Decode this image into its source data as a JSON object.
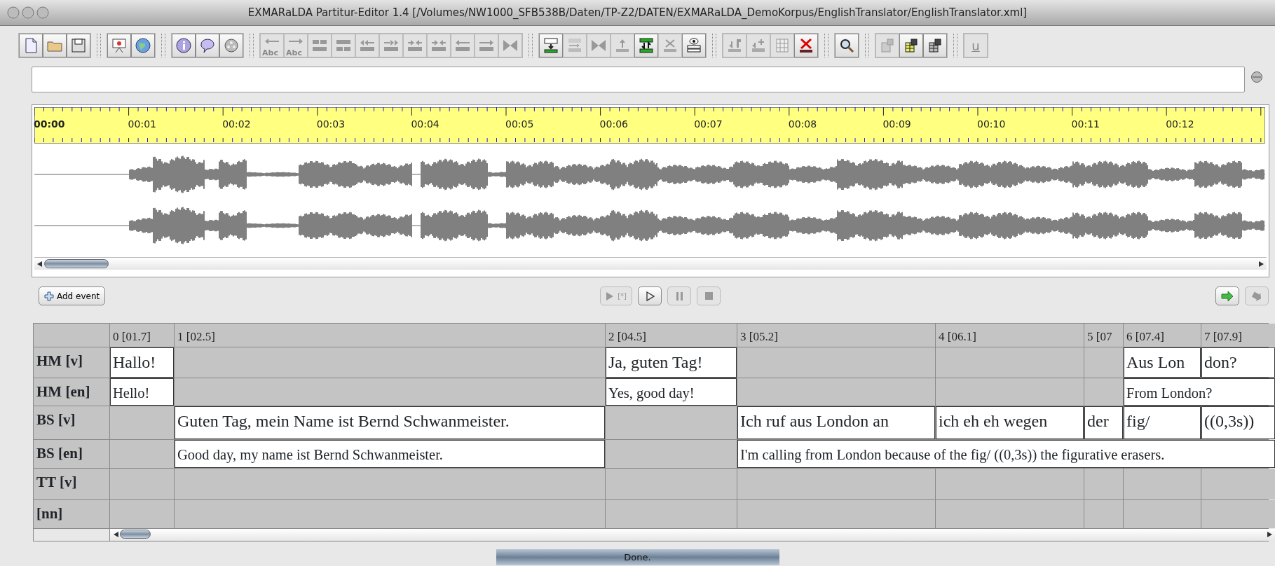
{
  "window": {
    "title": "EXMARaLDA Partitur-Editor 1.4 [/Volumes/NW1000_SFB538B/Daten/TP-Z2/DATEN/EXMARaLDA_DemoKorpus/EnglishTranslator/EnglishTranslator.xml]"
  },
  "toolbar": {
    "groups": [
      {
        "buttons": [
          {
            "disabled": false
          },
          {
            "disabled": false
          },
          {
            "disabled": false
          }
        ]
      },
      {
        "buttons": [
          {
            "disabled": false
          },
          {
            "disabled": false
          }
        ]
      },
      {
        "buttons": [
          {
            "disabled": false
          },
          {
            "disabled": false
          },
          {
            "disabled": false
          }
        ]
      },
      {
        "buttons": [
          {
            "label": "Abc",
            "disabled": true
          },
          {
            "label": "Abc",
            "disabled": true
          },
          {
            "disabled": true
          },
          {
            "disabled": true
          },
          {
            "disabled": true
          },
          {
            "disabled": true
          },
          {
            "disabled": true
          },
          {
            "disabled": true
          },
          {
            "disabled": true
          },
          {
            "disabled": true
          },
          {
            "disabled": true
          }
        ]
      },
      {
        "buttons": [
          {
            "disabled": false
          },
          {
            "disabled": true
          },
          {
            "disabled": true
          },
          {
            "disabled": true
          },
          {
            "disabled": false
          },
          {
            "disabled": true
          },
          {
            "disabled": false
          }
        ]
      },
      {
        "buttons": [
          {
            "disabled": true
          },
          {
            "disabled": true
          },
          {
            "disabled": true
          },
          {
            "disabled": false
          }
        ]
      },
      {
        "buttons": [
          {
            "disabled": false
          }
        ]
      },
      {
        "buttons": [
          {
            "disabled": true
          },
          {
            "disabled": false
          },
          {
            "disabled": false
          }
        ]
      },
      {
        "buttons": [
          {
            "label": "u",
            "disabled": true
          }
        ]
      }
    ]
  },
  "timeline": {
    "ruler": [
      {
        "text": "00:00",
        "current": true
      },
      {
        "text": "00:01",
        "current": false
      },
      {
        "text": "00:02",
        "current": false
      },
      {
        "text": "00:03",
        "current": false
      },
      {
        "text": "00:04",
        "current": false
      },
      {
        "text": "00:05",
        "current": false
      },
      {
        "text": "00:06",
        "current": false
      },
      {
        "text": "00:07",
        "current": false
      },
      {
        "text": "00:08",
        "current": false
      },
      {
        "text": "00:09",
        "current": false
      },
      {
        "text": "00:10",
        "current": false
      },
      {
        "text": "00:11",
        "current": false
      },
      {
        "text": "00:12",
        "current": false
      }
    ]
  },
  "add_event": {
    "label": "Add event"
  },
  "player": {
    "buttons": [
      {
        "kind": "play-selection",
        "label": "[*]",
        "disabled": true
      },
      {
        "kind": "play",
        "disabled": false
      },
      {
        "kind": "pause",
        "disabled": true
      },
      {
        "kind": "stop",
        "disabled": true
      }
    ]
  },
  "nav_buttons": [
    {
      "disabled": false
    },
    {
      "disabled": true
    }
  ],
  "partitur": {
    "columns": [
      "0 [01.7]",
      "1 [02.5]",
      "2 [04.5]",
      "3 [05.2]",
      "4 [06.1]",
      "5 [07",
      "6 [07.4]",
      "7 [07.9]"
    ],
    "rows": [
      {
        "label": "HM [v]",
        "kind": "verbal",
        "cells": [
          {
            "kind": "event",
            "text": "Hallo!"
          },
          {
            "kind": "empty"
          },
          {
            "kind": "event",
            "text": "Ja, guten Tag!"
          },
          {
            "kind": "empty"
          },
          {
            "kind": "empty"
          },
          {
            "kind": "empty"
          },
          {
            "kind": "event",
            "text": "Aus Lon"
          },
          {
            "kind": "event",
            "text": "don?"
          }
        ]
      },
      {
        "label": "HM [en]",
        "kind": "translation",
        "cells": [
          {
            "kind": "event",
            "text": "Hello!"
          },
          {
            "kind": "empty"
          },
          {
            "kind": "event",
            "text": "Yes, good day!"
          },
          {
            "kind": "empty"
          },
          {
            "kind": "empty"
          },
          {
            "kind": "empty"
          },
          {
            "kind": "event",
            "text": "From London?"
          },
          {
            "kind": "continued"
          }
        ]
      },
      {
        "label": "BS [v]",
        "kind": "verbal",
        "cells": [
          {
            "kind": "empty"
          },
          {
            "kind": "event",
            "text": "Guten Tag, mein Name ist Bernd Schwanmeister."
          },
          {
            "kind": "empty"
          },
          {
            "kind": "event",
            "text": "Ich ruf aus London an"
          },
          {
            "kind": "event",
            "text": "ich eh eh wegen"
          },
          {
            "kind": "event",
            "text": "der"
          },
          {
            "kind": "event",
            "text": "fig/"
          },
          {
            "kind": "event",
            "text": "((0,3s))"
          }
        ]
      },
      {
        "label": "BS [en]",
        "kind": "translation",
        "cells": [
          {
            "kind": "empty"
          },
          {
            "kind": "event",
            "text": "Good day, my name ist Bernd Schwanmeister."
          },
          {
            "kind": "empty"
          },
          {
            "kind": "event",
            "text": "I'm calling from London because of the fig/ ((0,3s)) the figurative erasers."
          },
          {
            "kind": "continued"
          },
          {
            "kind": "continued"
          },
          {
            "kind": "continued"
          },
          {
            "kind": "continued"
          }
        ]
      },
      {
        "label": "TT [v]",
        "kind": "verbal",
        "cells": [
          {
            "kind": "empty"
          },
          {
            "kind": "empty"
          },
          {
            "kind": "empty"
          },
          {
            "kind": "empty"
          },
          {
            "kind": "empty"
          },
          {
            "kind": "empty"
          },
          {
            "kind": "empty"
          },
          {
            "kind": "empty"
          }
        ]
      },
      {
        "label": "[nn]",
        "kind": "verbal",
        "cells": [
          {
            "kind": "empty"
          },
          {
            "kind": "empty"
          },
          {
            "kind": "empty"
          },
          {
            "kind": "empty"
          },
          {
            "kind": "empty"
          },
          {
            "kind": "empty"
          },
          {
            "kind": "empty"
          },
          {
            "kind": "empty"
          }
        ]
      }
    ]
  },
  "status_bar": "Done."
}
